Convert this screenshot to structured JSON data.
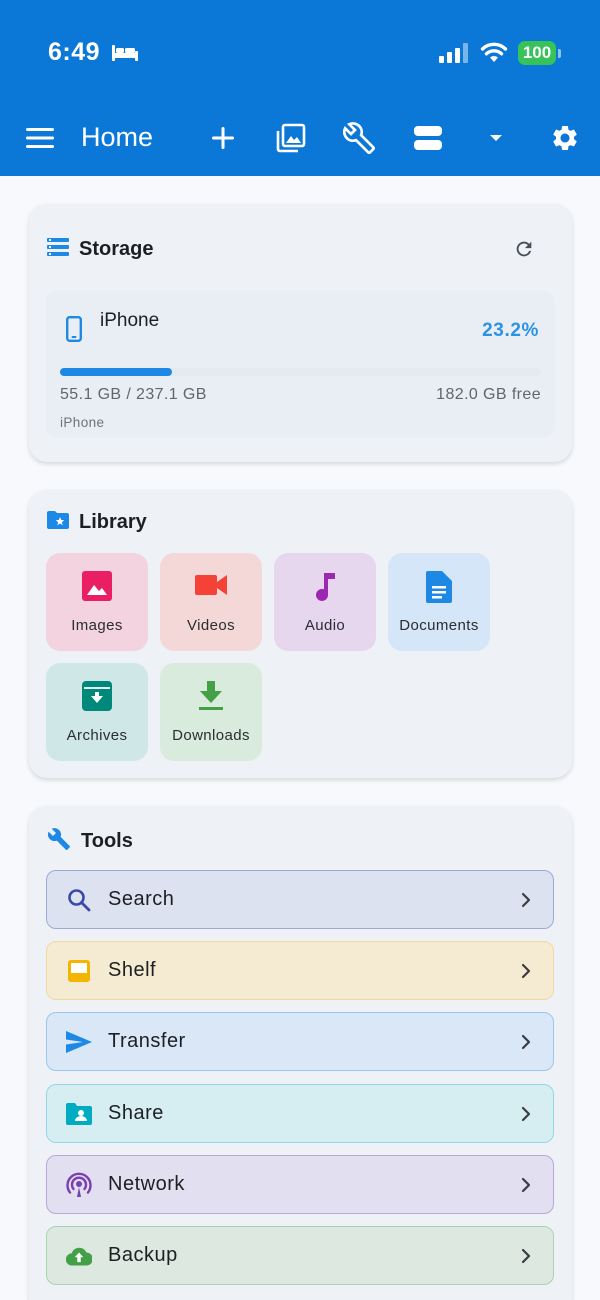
{
  "status_bar": {
    "time": "6:49",
    "battery": "100"
  },
  "app_bar": {
    "title": "Home"
  },
  "storage": {
    "title": "Storage",
    "device": {
      "name": "iPhone",
      "percent_label": "23.2%",
      "percent_used": 23.2,
      "used_total": "55.1 GB / 237.1 GB",
      "free": "182.0 GB free",
      "subtitle": "iPhone"
    }
  },
  "library": {
    "title": "Library",
    "items": [
      {
        "label": "Images",
        "icon": "image-icon",
        "color": "#e91e63",
        "bg": "#f2d3df"
      },
      {
        "label": "Videos",
        "icon": "videocam-icon",
        "color": "#f44336",
        "bg": "#f4d8d8"
      },
      {
        "label": "Audio",
        "icon": "music-note-icon",
        "color": "#9c27b0",
        "bg": "#e6d6ee"
      },
      {
        "label": "Documents",
        "icon": "document-icon",
        "color": "#1e88e5",
        "bg": "#d4e6f7"
      },
      {
        "label": "Archives",
        "icon": "archive-icon",
        "color": "#00897b",
        "bg": "#cfe7e7"
      },
      {
        "label": "Downloads",
        "icon": "download-icon",
        "color": "#43a047",
        "bg": "#d8ebdc"
      }
    ]
  },
  "tools": {
    "title": "Tools",
    "items": [
      {
        "label": "Search",
        "icon": "search-icon",
        "color": "#3949ab",
        "bg": "#dde2f0",
        "border": "#9ea8d9"
      },
      {
        "label": "Shelf",
        "icon": "inbox-tray-icon",
        "color": "#f2b600",
        "bg": "#f5ebd3",
        "border": "#f0d9a0"
      },
      {
        "label": "Transfer",
        "icon": "send-icon",
        "color": "#1e88e5",
        "bg": "#d9e7f6",
        "border": "#9cc6ec"
      },
      {
        "label": "Share",
        "icon": "shared-folder-icon",
        "color": "#00acc1",
        "bg": "#d6edf2",
        "border": "#94d7e2"
      },
      {
        "label": "Network",
        "icon": "podcast-icon",
        "color": "#7b3fb1",
        "bg": "#e2dff0",
        "border": "#bda6dc"
      },
      {
        "label": "Backup",
        "icon": "cloud-upload-icon",
        "color": "#43a047",
        "bg": "#dde9e0",
        "border": "#a9d4b1"
      }
    ]
  }
}
